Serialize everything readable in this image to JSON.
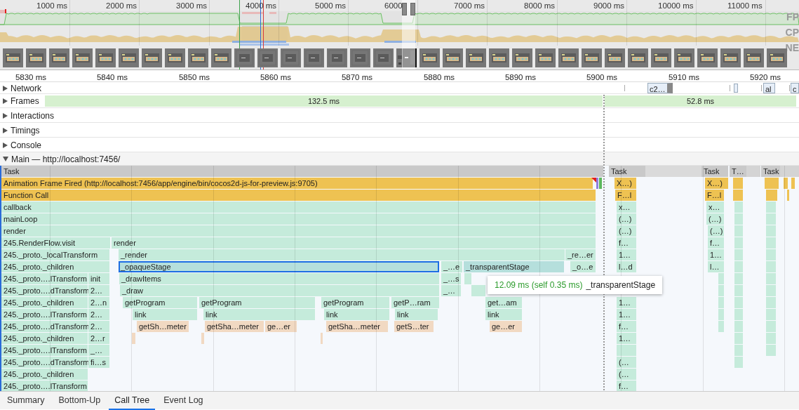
{
  "overview": {
    "ruler": [
      "1000 ms",
      "2000 ms",
      "3000 ms",
      "4000 ms",
      "5000 ms",
      "6000",
      "7000 ms",
      "8000 ms",
      "9000 ms",
      "10000 ms",
      "11000 ms"
    ],
    "track_labels": [
      "FP",
      "CP",
      "NE"
    ]
  },
  "ruler": [
    "5830 ms",
    "5840 ms",
    "5850 ms",
    "5860 ms",
    "5870 ms",
    "5880 ms",
    "5890 ms",
    "5900 ms",
    "5910 ms",
    "5920 ms"
  ],
  "tracks": [
    {
      "label": "Network",
      "kind": "network",
      "expanded": false,
      "items": [
        "c2…",
        "al",
        "c"
      ]
    },
    {
      "label": "Frames",
      "kind": "frames",
      "expanded": false,
      "items": [
        "132.5 ms",
        "52.8 ms"
      ]
    },
    {
      "label": "Interactions",
      "kind": "plain",
      "expanded": false
    },
    {
      "label": "Timings",
      "kind": "plain",
      "expanded": false
    },
    {
      "label": "Console",
      "kind": "plain",
      "expanded": false
    },
    {
      "label": "Main — http://localhost:7456/",
      "kind": "main",
      "expanded": true
    }
  ],
  "flame_rows": [
    [
      {
        "label": "Task",
        "kind": "task",
        "selected": false,
        "hovered": false
      },
      {
        "label": "Task",
        "kind": "task",
        "selected": false,
        "hovered": false
      },
      {
        "label": "Task",
        "kind": "task",
        "selected": false,
        "hovered": false
      },
      {
        "label": "T…",
        "kind": "task",
        "selected": false,
        "hovered": false
      },
      {
        "label": "Task",
        "kind": "task",
        "selected": false,
        "hovered": false
      }
    ],
    [
      {
        "label": "Animation Frame Fired (http://localhost:7456/app/engine/bin/cocos2d-js-for-preview.js:9705)",
        "kind": "event",
        "selected": false,
        "hovered": false
      },
      {
        "label": "X…)",
        "kind": "event",
        "selected": false,
        "hovered": false
      },
      {
        "label": "X…)",
        "kind": "event",
        "selected": false,
        "hovered": false
      }
    ],
    [
      {
        "label": "Function Call",
        "kind": "event",
        "selected": false,
        "hovered": false
      },
      {
        "label": "F…l",
        "kind": "event",
        "selected": false,
        "hovered": false
      },
      {
        "label": "F…l",
        "kind": "event",
        "selected": false,
        "hovered": false
      }
    ],
    [
      {
        "label": "callback",
        "kind": "script",
        "selected": false,
        "hovered": false
      },
      {
        "label": "x…",
        "kind": "script",
        "selected": false,
        "hovered": false
      },
      {
        "label": "x…",
        "kind": "script",
        "selected": false,
        "hovered": false
      }
    ],
    [
      {
        "label": "mainLoop",
        "kind": "script",
        "selected": false,
        "hovered": false
      },
      {
        "label": "(…)",
        "kind": "script",
        "selected": false,
        "hovered": false
      },
      {
        "label": "(…)",
        "kind": "script",
        "selected": false,
        "hovered": false
      }
    ],
    [
      {
        "label": "render",
        "kind": "script",
        "selected": false,
        "hovered": false
      },
      {
        "label": "(…)",
        "kind": "script",
        "selected": false,
        "hovered": false
      },
      {
        "label": "(…)",
        "kind": "script",
        "selected": false,
        "hovered": false
      }
    ],
    [
      {
        "label": "245.RenderFlow.visit",
        "kind": "script",
        "selected": false,
        "hovered": false
      },
      {
        "label": "render",
        "kind": "script",
        "selected": false,
        "hovered": false
      },
      {
        "label": "f…",
        "kind": "script",
        "selected": false,
        "hovered": false
      },
      {
        "label": "f…",
        "kind": "script",
        "selected": false,
        "hovered": false
      }
    ],
    [
      {
        "label": "245._proto._localTransform",
        "kind": "script",
        "selected": false,
        "hovered": false
      },
      {
        "label": "_render",
        "kind": "script",
        "selected": false,
        "hovered": false
      },
      {
        "label": "_re…er",
        "kind": "script",
        "selected": false,
        "hovered": false
      },
      {
        "label": "1…",
        "kind": "script",
        "selected": false,
        "hovered": false
      },
      {
        "label": "1…",
        "kind": "script",
        "selected": false,
        "hovered": false
      }
    ],
    [
      {
        "label": "245._proto._children",
        "kind": "script",
        "selected": false,
        "hovered": false
      },
      {
        "label": "_opaqueStage",
        "kind": "script",
        "selected": true,
        "hovered": false
      },
      {
        "label": "_…e",
        "kind": "script",
        "selected": false,
        "hovered": false
      },
      {
        "label": "_transparentStage",
        "kind": "script",
        "selected": false,
        "hovered": true
      },
      {
        "label": "_o…e",
        "kind": "script",
        "selected": false,
        "hovered": false
      },
      {
        "label": "l…d",
        "kind": "script",
        "selected": false,
        "hovered": false
      },
      {
        "label": "l…",
        "kind": "script",
        "selected": false,
        "hovered": false
      }
    ],
    [
      {
        "label": "245._proto….lTransform",
        "kind": "script",
        "selected": false,
        "hovered": false
      },
      {
        "label": "init",
        "kind": "script",
        "selected": false,
        "hovered": false
      },
      {
        "label": "_drawItems",
        "kind": "script",
        "selected": false,
        "hovered": false
      },
      {
        "label": "_…s",
        "kind": "script",
        "selected": false,
        "hovered": false
      }
    ],
    [
      {
        "label": "245._proto….dTransform",
        "kind": "script",
        "selected": false,
        "hovered": false
      },
      {
        "label": "2…",
        "kind": "script",
        "selected": false,
        "hovered": false
      },
      {
        "label": "_draw",
        "kind": "script",
        "selected": false,
        "hovered": false
      },
      {
        "label": "_…",
        "kind": "script",
        "selected": false,
        "hovered": false
      }
    ],
    [
      {
        "label": "245._proto._children",
        "kind": "script",
        "selected": false,
        "hovered": false
      },
      {
        "label": "2…n",
        "kind": "script",
        "selected": false,
        "hovered": false
      },
      {
        "label": "getProgram",
        "kind": "script",
        "selected": false,
        "hovered": false
      },
      {
        "label": "getProgram",
        "kind": "script",
        "selected": false,
        "hovered": false
      },
      {
        "label": "getProgram",
        "kind": "script",
        "selected": false,
        "hovered": false
      },
      {
        "label": "getP…ram",
        "kind": "script",
        "selected": false,
        "hovered": false
      },
      {
        "label": "get…am",
        "kind": "script",
        "selected": false,
        "hovered": false
      },
      {
        "label": "1…",
        "kind": "script",
        "selected": false,
        "hovered": false
      }
    ],
    [
      {
        "label": "245._proto….lTransform",
        "kind": "script",
        "selected": false,
        "hovered": false
      },
      {
        "label": "2…",
        "kind": "script",
        "selected": false,
        "hovered": false
      },
      {
        "label": "link",
        "kind": "script",
        "selected": false,
        "hovered": false
      },
      {
        "label": "link",
        "kind": "script",
        "selected": false,
        "hovered": false
      },
      {
        "label": "link",
        "kind": "script",
        "selected": false,
        "hovered": false
      },
      {
        "label": "link",
        "kind": "script",
        "selected": false,
        "hovered": false
      },
      {
        "label": "link",
        "kind": "script",
        "selected": false,
        "hovered": false
      },
      {
        "label": "1…",
        "kind": "script",
        "selected": false,
        "hovered": false
      }
    ],
    [
      {
        "label": "245._proto….dTransform",
        "kind": "script",
        "selected": false,
        "hovered": false
      },
      {
        "label": "2…",
        "kind": "script",
        "selected": false,
        "hovered": false
      },
      {
        "label": "getSh…meter",
        "kind": "shader",
        "selected": false,
        "hovered": false
      },
      {
        "label": "getSha…meter",
        "kind": "shader",
        "selected": false,
        "hovered": false
      },
      {
        "label": "ge…er",
        "kind": "shader",
        "selected": false,
        "hovered": false
      },
      {
        "label": "getSha…meter",
        "kind": "shader",
        "selected": false,
        "hovered": false
      },
      {
        "label": "getS…ter",
        "kind": "shader",
        "selected": false,
        "hovered": false
      },
      {
        "label": "ge…er",
        "kind": "shader",
        "selected": false,
        "hovered": false
      },
      {
        "label": "f…",
        "kind": "script",
        "selected": false,
        "hovered": false
      }
    ],
    [
      {
        "label": "245._proto._children",
        "kind": "script",
        "selected": false,
        "hovered": false
      },
      {
        "label": "2…r",
        "kind": "script",
        "selected": false,
        "hovered": false
      },
      {
        "label": "1…",
        "kind": "script",
        "selected": false,
        "hovered": false
      }
    ],
    [
      {
        "label": "245._proto….lTransform",
        "kind": "script",
        "selected": false,
        "hovered": false
      },
      {
        "label": "_…",
        "kind": "script",
        "selected": false,
        "hovered": false
      }
    ],
    [
      {
        "label": "245._proto….dTransform",
        "kind": "script",
        "selected": false,
        "hovered": false
      },
      {
        "label": "fi…s",
        "kind": "script",
        "selected": false,
        "hovered": false
      },
      {
        "label": "(…",
        "kind": "script",
        "selected": false,
        "hovered": false
      }
    ],
    [
      {
        "label": "245._proto._children",
        "kind": "script",
        "selected": false,
        "hovered": false
      },
      {
        "label": "(…",
        "kind": "script",
        "selected": false,
        "hovered": false
      }
    ],
    [
      {
        "label": "245._proto….lTransform",
        "kind": "script",
        "selected": false,
        "hovered": false
      },
      {
        "label": "f…",
        "kind": "script",
        "selected": false,
        "hovered": false
      }
    ]
  ],
  "tooltip": {
    "duration": "12.09 ms (self 0.35 ms)",
    "name": "_transparentStage"
  },
  "bottom_tabs": [
    {
      "label": "Summary",
      "selected": false
    },
    {
      "label": "Bottom-Up",
      "selected": false
    },
    {
      "label": "Call Tree",
      "selected": true
    },
    {
      "label": "Event Log",
      "selected": false
    }
  ]
}
